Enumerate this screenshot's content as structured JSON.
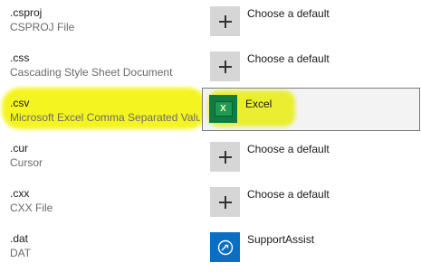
{
  "rows": [
    {
      "ext": ".csproj",
      "desc": "CSPROJ File",
      "app": "Choose a default",
      "icon": "plus-icon"
    },
    {
      "ext": ".css",
      "desc": "Cascading Style Sheet Document",
      "app": "Choose a default",
      "icon": "plus-icon"
    },
    {
      "ext": ".csv",
      "desc": "Microsoft Excel Comma Separated Values...",
      "app": "Excel",
      "icon": "excel-icon"
    },
    {
      "ext": ".cur",
      "desc": "Cursor",
      "app": "Choose a default",
      "icon": "plus-icon"
    },
    {
      "ext": ".cxx",
      "desc": "CXX File",
      "app": "Choose a default",
      "icon": "plus-icon"
    },
    {
      "ext": ".dat",
      "desc": "DAT",
      "app": "SupportAssist",
      "icon": "supportassist-icon"
    }
  ],
  "colors": {
    "highlight": "#f4f415",
    "excel_green": "#107c41",
    "supportassist_blue": "#0a6fc2",
    "tile_gray": "#d6d6d6"
  },
  "excel_glyph": "X"
}
